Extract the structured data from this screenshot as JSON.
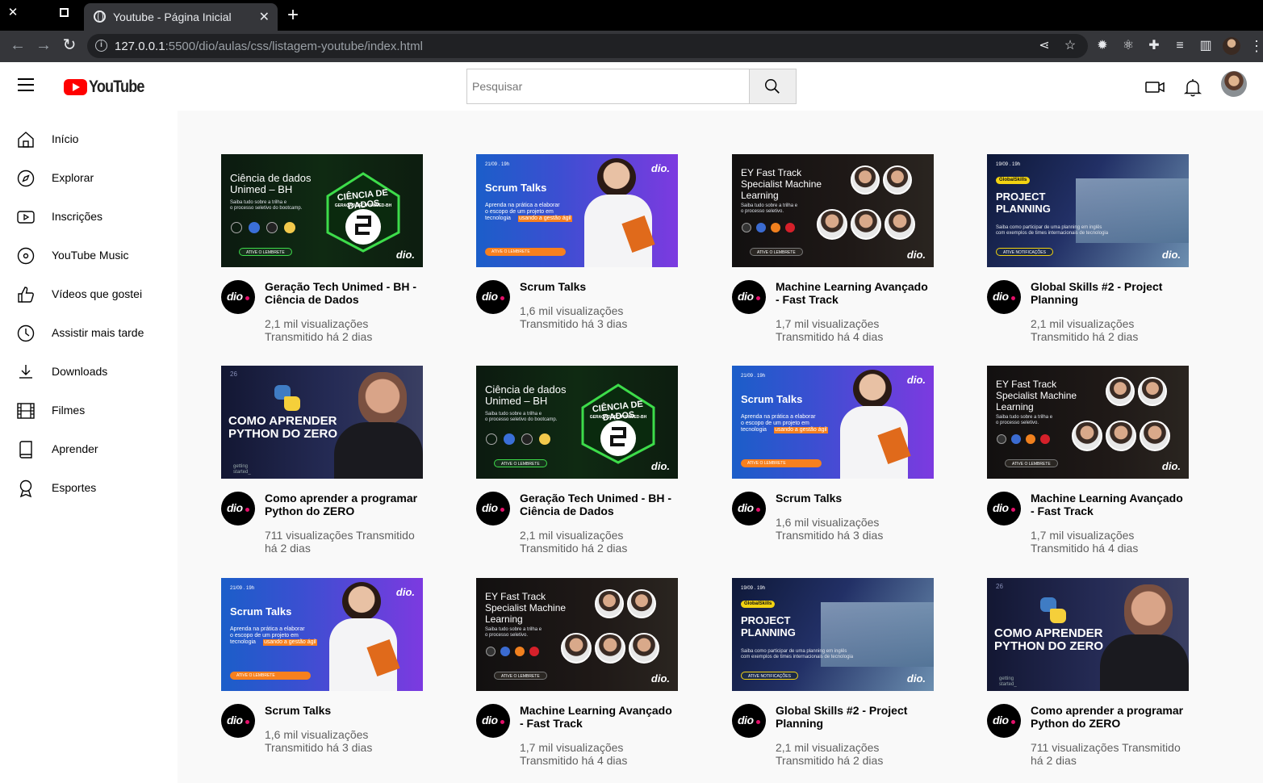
{
  "browser": {
    "tab_title": "Youtube - Página Inicial",
    "url_host": "127.0.0.1",
    "url_rest": ":5500/dio/aulas/css/listagem-youtube/index.html"
  },
  "header": {
    "logo_text": "YouTube",
    "search_placeholder": "Pesquisar"
  },
  "sidebar": {
    "items": [
      {
        "label": "Início",
        "icon": "home-icon"
      },
      {
        "label": "Explorar",
        "icon": "compass-icon"
      },
      {
        "label": "Inscrições",
        "icon": "subscriptions-icon"
      },
      {
        "label": "YouTube Music",
        "icon": "music-disc-icon"
      },
      {
        "label": "Vídeos que gostei",
        "icon": "thumbs-up-icon"
      },
      {
        "label": "Assistir mais tarde",
        "icon": "clock-icon"
      },
      {
        "label": "Downloads",
        "icon": "download-icon"
      },
      {
        "label": "Filmes",
        "icon": "film-icon"
      },
      {
        "label": "Aprender",
        "icon": "book-icon"
      },
      {
        "label": "Esportes",
        "icon": "trophy-icon"
      }
    ]
  },
  "thumbs": {
    "ciencia": {
      "line1": "Ciência de dados",
      "line2": "Unimed – BH",
      "sub": "Saiba tudo sobre a trilha e\no processo seletivo do bootcamp.",
      "badge_big": "CIÊNCIA DE DADOS",
      "badge_small": "GERAÇÃO TECH UNIMED-BH",
      "button": "ATIVE O LEMBRETE",
      "brand": "dio."
    },
    "scrum": {
      "date": "21/09 . 19h",
      "title": "Scrum Talks",
      "sub": "Aprenda na prática a elaborar\no escopo de um projeto em\ntecnologia",
      "highlight": "usando a gestão ágil",
      "button": "ATIVE O LEMBRETE",
      "brand": "dio."
    },
    "ey": {
      "title": "EY Fast Track\nSpecialist Machine\nLearning",
      "sub": "Saiba tudo sobre a trilha e\no processo seletivo.",
      "button": "ATIVE O LEMBRETE",
      "brand": "dio."
    },
    "global": {
      "date": "19/09 . 19h",
      "tag": "GlobalSkills",
      "title": "PROJECT\nPLANNING",
      "sub": "Saiba como participar de uma planning em inglês\ncom exemplos de times internacionais de tecnologia",
      "button": "ATIVE NOTIFICAÇÕES",
      "brand": "dio."
    },
    "python": {
      "num": "26",
      "title": "COMO APRENDER\nPYTHON DO ZERO",
      "shirt": "getting\nstarted_"
    }
  },
  "videos": [
    {
      "thumb": "ciencia",
      "title": "Geração Tech Unimed - BH - Ciência de Dados",
      "views": "2,1 mil visualizações",
      "when": "Transmitido há 2 dias",
      "meta_inline": false
    },
    {
      "thumb": "scrum",
      "title": "Scrum Talks",
      "views": "1,6 mil visualizações",
      "when": "Transmitido há 3 dias",
      "meta_inline": false
    },
    {
      "thumb": "ey",
      "title": "Machine Learning Avançado - Fast Track",
      "views": "1,7 mil visualizações",
      "when": "Transmitido há 4 dias",
      "meta_inline": false
    },
    {
      "thumb": "global",
      "title": "Global Skills #2 - Project Planning",
      "views": "2,1 mil visualizações",
      "when": "Transmitido há 2 dias",
      "meta_inline": false
    },
    {
      "thumb": "python",
      "title": "Como aprender a programar Python do ZERO",
      "views": "711 visualizações",
      "when": "Transmitido há 2 dias",
      "meta_inline": true
    },
    {
      "thumb": "ciencia",
      "title": "Geração Tech Unimed - BH - Ciência de Dados",
      "views": "2,1 mil visualizações",
      "when": "Transmitido há 2 dias",
      "meta_inline": false
    },
    {
      "thumb": "scrum",
      "title": "Scrum Talks",
      "views": "1,6 mil visualizações",
      "when": "Transmitido há 3 dias",
      "meta_inline": false
    },
    {
      "thumb": "ey",
      "title": "Machine Learning Avançado - Fast Track",
      "views": "1,7 mil visualizações",
      "when": "Transmitido há 4 dias",
      "meta_inline": false
    },
    {
      "thumb": "scrum",
      "title": "Scrum Talks",
      "views": "1,6 mil visualizações",
      "when": "Transmitido há 3 dias",
      "meta_inline": false
    },
    {
      "thumb": "ey",
      "title": "Machine Learning Avançado - Fast Track",
      "views": "1,7 mil visualizações",
      "when": "Transmitido há 4 dias",
      "meta_inline": false
    },
    {
      "thumb": "global",
      "title": "Global Skills #2 - Project Planning",
      "views": "2,1 mil visualizações",
      "when": "Transmitido há 2 dias",
      "meta_inline": false
    },
    {
      "thumb": "python",
      "title": "Como aprender a programar Python do ZERO",
      "views": "711 visualizações",
      "when": "Transmitido há 2 dias",
      "meta_inline": true
    }
  ],
  "colors": {
    "brand_red": "#ff0000",
    "dio_pink": "#e4106a",
    "scrum_highlight": "#f7801e"
  }
}
